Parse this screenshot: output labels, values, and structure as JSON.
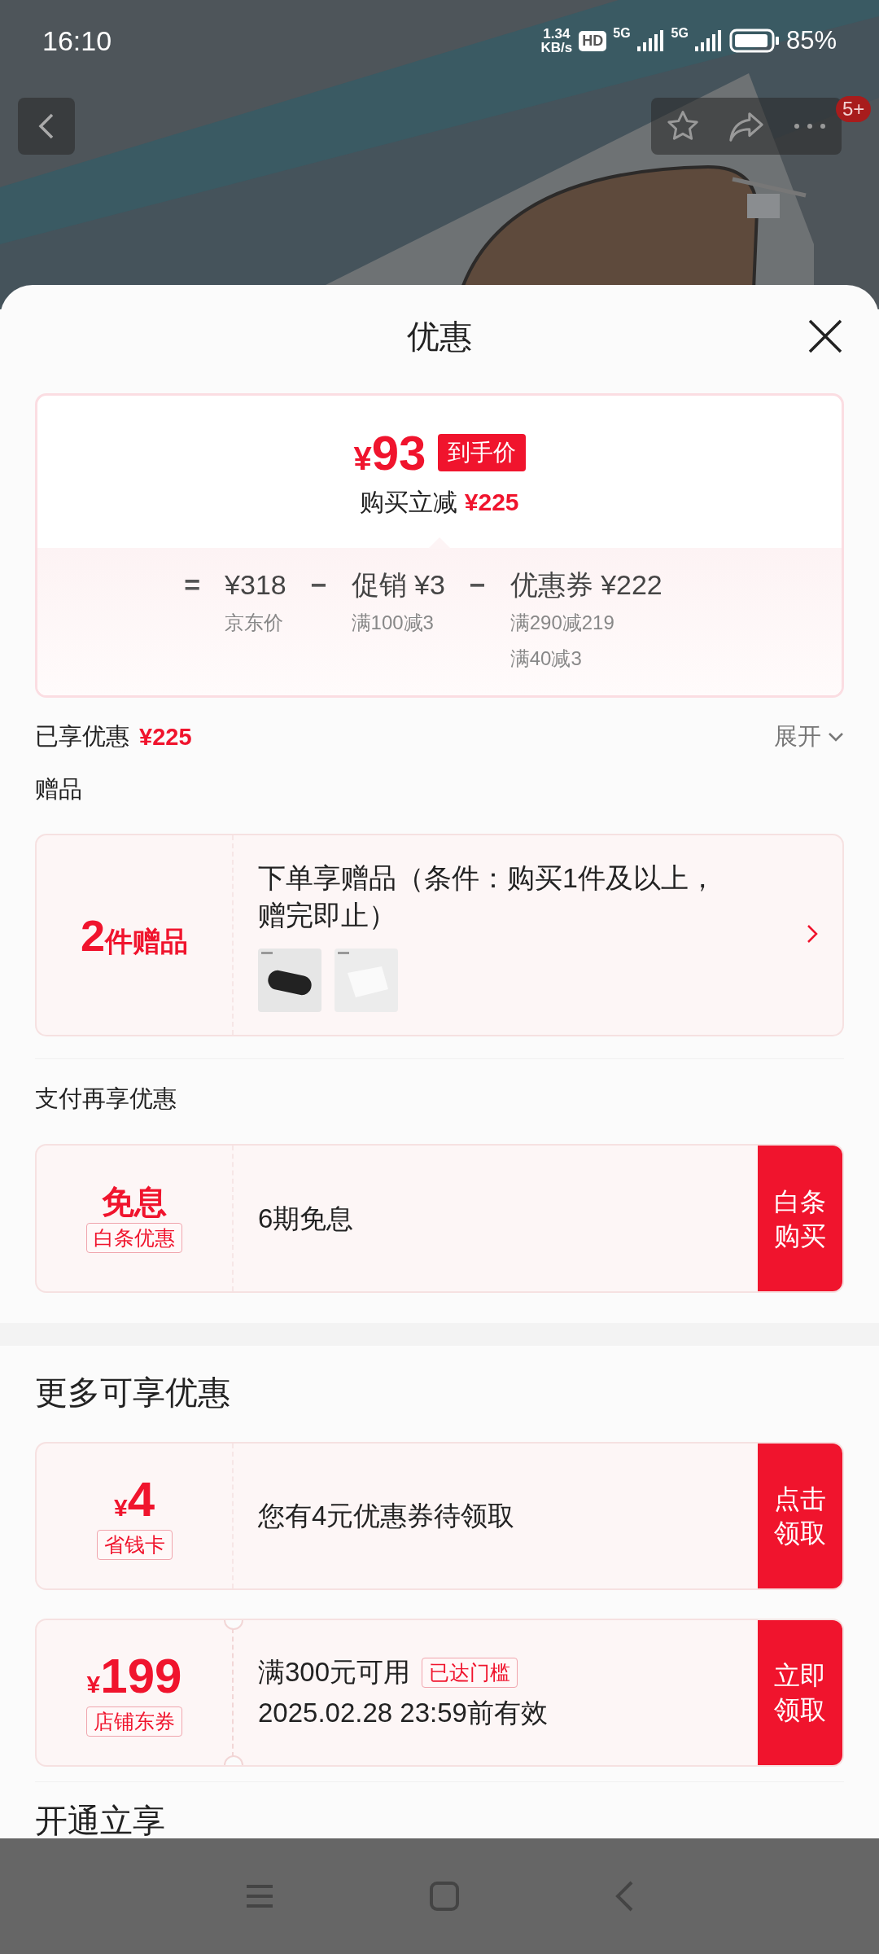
{
  "status_bar": {
    "time": "16:10",
    "net_speed": [
      "1.34",
      "KB/s"
    ],
    "hd_badge": "HD",
    "networks": [
      "5G",
      "5G"
    ],
    "battery": "85%"
  },
  "top_bar": {
    "badge": "5+"
  },
  "sheet": {
    "title": "优惠"
  },
  "price_card": {
    "final_currency": "¥",
    "final_amount": "93",
    "final_tag": "到手价",
    "saving_label": "购买立减",
    "saving_amount": "¥225",
    "equation": [
      {
        "kind": "operator",
        "text": "="
      },
      {
        "kind": "term",
        "value": "¥318",
        "notes": [
          "京东价"
        ]
      },
      {
        "kind": "operator",
        "text": "−"
      },
      {
        "kind": "term",
        "value": "促销 ¥3",
        "notes": [
          "满100减3"
        ]
      },
      {
        "kind": "operator",
        "text": "−"
      },
      {
        "kind": "term",
        "value": "优惠券 ¥222",
        "notes": [
          "满290减219",
          "满40减3"
        ]
      }
    ]
  },
  "enjoyed": {
    "label": "已享优惠",
    "amount": "¥225",
    "toggle": "展开"
  },
  "gifts": {
    "heading": "赠品",
    "count": "2",
    "count_unit": "件赠品",
    "title": "下单享赠品（条件：购买1件及以上，赠完即止）"
  },
  "pay_section": {
    "heading": "支付再享优惠",
    "offers": [
      {
        "badge_title": "免息",
        "badge_tag": "白条优惠",
        "text": "6期免息",
        "button": "白条购买"
      }
    ]
  },
  "more_section": {
    "heading": "更多可享优惠",
    "coupons": [
      {
        "kind": "card",
        "currency": "¥",
        "amount": "4",
        "tag": "省钱卡",
        "lines": [
          "您有4元优惠券待领取"
        ],
        "button": "点击领取"
      },
      {
        "kind": "ticket",
        "currency": "¥",
        "amount": "199",
        "tag": "店铺东券",
        "lines": [
          "满300元可用",
          "2025.02.28 23:59前有效"
        ],
        "status_tag": "已达门槛",
        "button": "立即领取"
      }
    ]
  },
  "next_heading": "开通立享"
}
